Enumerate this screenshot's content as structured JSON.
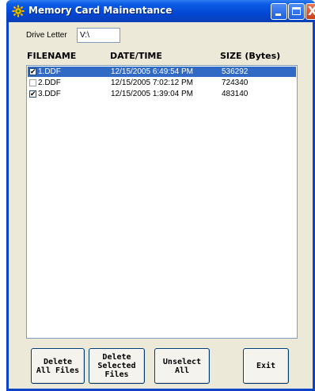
{
  "background_fragment": "e",
  "window": {
    "title": "Memory Card Mainentance",
    "icon": "app-gear-icon",
    "controls": {
      "minimize": "minimize-icon",
      "maximize": "maximize-icon",
      "close": "X"
    }
  },
  "drive": {
    "label": "Drive Letter",
    "value": "V:\\"
  },
  "columns": {
    "filename": "FILENAME",
    "datetime": "DATE/TIME",
    "size": "SIZE (Bytes)"
  },
  "files": [
    {
      "name": "1.DDF",
      "datetime": "12/15/2005 6:49:54 PM",
      "size": "536292",
      "checked": true,
      "selected": true
    },
    {
      "name": "2.DDF",
      "datetime": "12/15/2005 7:02:12 PM",
      "size": "724340",
      "checked": false,
      "selected": false
    },
    {
      "name": "3.DDF",
      "datetime": "12/15/2005 1:39:04 PM",
      "size": "483140",
      "checked": true,
      "selected": false
    }
  ],
  "buttons": {
    "delete_all": "Delete\nAll Files",
    "delete_selected": "Delete\nSelected\nFiles",
    "unselect_all": "Unselect\nAll",
    "exit": "Exit"
  },
  "colors": {
    "titlebar": "#0347d4",
    "selection": "#316ac5",
    "client": "#ece9d8"
  }
}
